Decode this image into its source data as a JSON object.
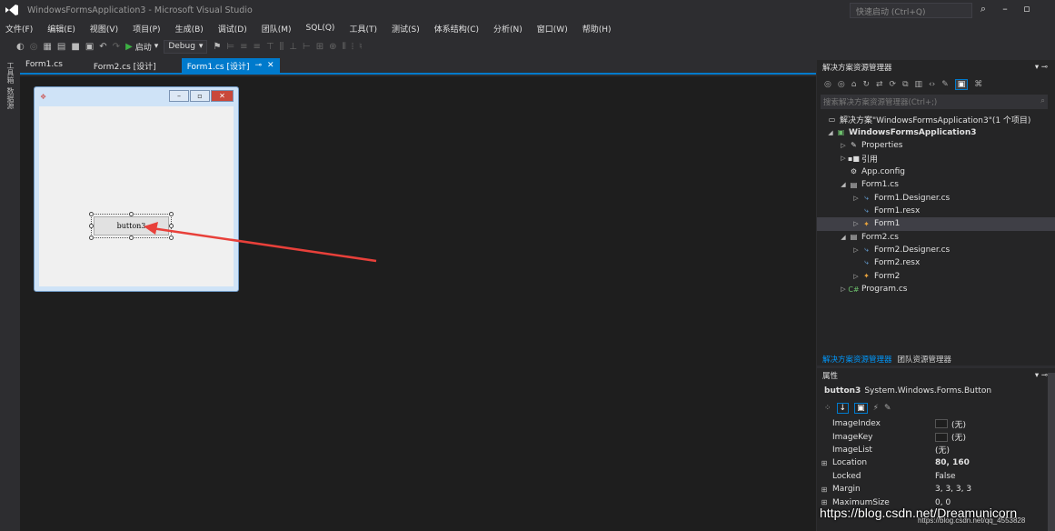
{
  "window": {
    "title": "WindowsFormsApplication3 - Microsoft Visual Studio",
    "quick_launch_placeholder": "快速启动 (Ctrl+Q)"
  },
  "menu": [
    "文件(F)",
    "编辑(E)",
    "视图(V)",
    "项目(P)",
    "生成(B)",
    "调试(D)",
    "团队(M)",
    "SQL(Q)",
    "工具(T)",
    "测试(S)",
    "体系结构(C)",
    "分析(N)",
    "窗口(W)",
    "帮助(H)"
  ],
  "toolbar": {
    "start_label": "启动",
    "config_value": "Debug"
  },
  "side_tabs": [
    "工具箱",
    "数据源"
  ],
  "doc_tabs": [
    {
      "label": "Form1.cs"
    },
    {
      "label": "Form2.cs [设计]"
    },
    {
      "label": "Form1.cs [设计]",
      "active": true
    }
  ],
  "designer": {
    "button_text": "button3"
  },
  "solution_explorer": {
    "title": "解决方案资源管理器",
    "search_placeholder": "搜索解决方案资源管理器(Ctrl+;)",
    "items": [
      {
        "label": "解决方案\"WindowsFormsApplication3\"(1 个项目)",
        "level": 0,
        "icon": "solution-icon"
      },
      {
        "label": "WindowsFormsApplication3",
        "level": 0,
        "icon": "csharp-project-icon",
        "bold": true,
        "expanded": true
      },
      {
        "label": "Properties",
        "level": 1,
        "icon": "wrench-icon"
      },
      {
        "label": "引用",
        "level": 1,
        "icon": "references-icon"
      },
      {
        "label": "App.config",
        "level": 1,
        "icon": "config-icon"
      },
      {
        "label": "Form1.cs",
        "level": 1,
        "icon": "form-file-icon",
        "expanded": true
      },
      {
        "label": "Form1.Designer.cs",
        "level": 2,
        "icon": "cs-file-icon"
      },
      {
        "label": "Form1.resx",
        "level": 2,
        "icon": "resx-file-icon"
      },
      {
        "label": "Form1",
        "level": 2,
        "icon": "class-icon",
        "selected": true
      },
      {
        "label": "Form2.cs",
        "level": 1,
        "icon": "form-file-icon",
        "expanded": true
      },
      {
        "label": "Form2.Designer.cs",
        "level": 2,
        "icon": "cs-file-icon"
      },
      {
        "label": "Form2.resx",
        "level": 2,
        "icon": "resx-file-icon"
      },
      {
        "label": "Form2",
        "level": 2,
        "icon": "class-icon"
      },
      {
        "label": "Program.cs",
        "level": 1,
        "icon": "csharp-file-icon"
      }
    ],
    "bottom_tabs": [
      {
        "label": "解决方案资源管理器",
        "active": true
      },
      {
        "label": "团队资源管理器"
      }
    ]
  },
  "properties": {
    "title": "属性",
    "object_name": "button3",
    "object_type": "System.Windows.Forms.Button",
    "rows": [
      {
        "name": "ImageIndex",
        "value": "(无)",
        "swatch": true
      },
      {
        "name": "ImageKey",
        "value": "(无)",
        "swatch": true
      },
      {
        "name": "ImageList",
        "value": "(无)"
      },
      {
        "name": "Location",
        "value": "80, 160",
        "expandable": true,
        "bold": true
      },
      {
        "name": "Locked",
        "value": "False"
      },
      {
        "name": "Margin",
        "value": "3, 3, 3, 3",
        "expandable": true
      },
      {
        "name": "MaximumSize",
        "value": "0, 0",
        "expandable": true
      }
    ]
  },
  "watermark": {
    "text": "https://blog.csdn.net/Dreamunicorn",
    "sub": "https://blog.csdn.net/qq_4553828"
  },
  "colors": {
    "accent": "#007acc",
    "background": "#2d2d30",
    "designer_bg": "#1e1e1e",
    "arrow": "#e8403a"
  }
}
